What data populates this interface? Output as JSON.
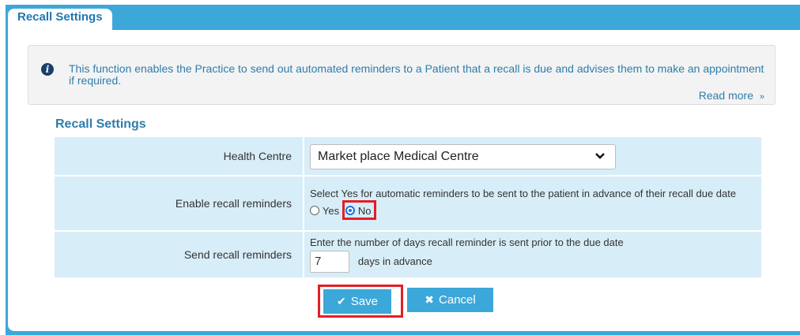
{
  "window": {
    "tab_label": "Recall Settings"
  },
  "info": {
    "icon": "info-icon",
    "text": "This function enables the Practice to send out automated reminders to a Patient that a recall is due and advises them to make an appointment if required.",
    "read_more": "Read more",
    "read_more_icon": "double-chevron-down"
  },
  "section": {
    "title": "Recall Settings"
  },
  "form": {
    "health_centre": {
      "label": "Health Centre",
      "value": "Market place Medical Centre"
    },
    "enable_reminders": {
      "label": "Enable recall reminders",
      "description": "Select Yes for automatic reminders to be sent to the patient in advance of their recall due date",
      "options": [
        "Yes",
        "No"
      ],
      "selected": "No"
    },
    "send_reminders": {
      "label": "Send recall reminders",
      "description": "Enter the number of days recall reminder is sent prior to the due date",
      "days_value": "7",
      "suffix": "days in advance"
    }
  },
  "buttons": {
    "save": "Save",
    "cancel": "Cancel"
  },
  "colors": {
    "accent": "#3ca7d9",
    "highlight": "#e21e26",
    "row_bg": "#d7edf7"
  }
}
